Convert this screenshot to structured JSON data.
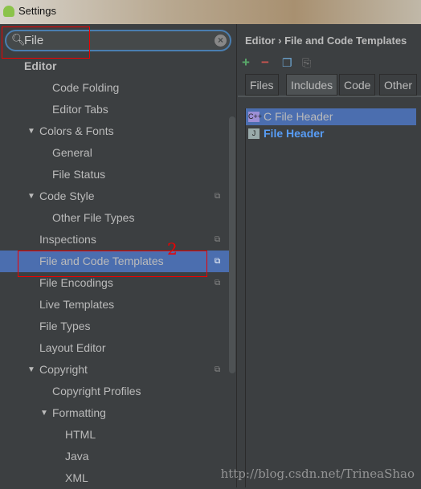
{
  "window": {
    "title": "Settings"
  },
  "search": {
    "value": "File"
  },
  "tree": [
    {
      "label": "Editor",
      "level": 0,
      "bold": true
    },
    {
      "label": "Code Folding",
      "level": 2
    },
    {
      "label": "Editor Tabs",
      "level": 2
    },
    {
      "label": "Colors & Fonts",
      "level": 1,
      "expanded": true
    },
    {
      "label": "General",
      "level": 2
    },
    {
      "label": "File Status",
      "level": 2
    },
    {
      "label": "Code Style",
      "level": 1,
      "expanded": true,
      "project": true
    },
    {
      "label": "Other File Types",
      "level": 2
    },
    {
      "label": "Inspections",
      "level": 1,
      "project": true
    },
    {
      "label": "File and Code Templates",
      "level": 1,
      "project": true,
      "selected": true
    },
    {
      "label": "File Encodings",
      "level": 1,
      "project": true
    },
    {
      "label": "Live Templates",
      "level": 1
    },
    {
      "label": "File Types",
      "level": 1
    },
    {
      "label": "Layout Editor",
      "level": 1
    },
    {
      "label": "Copyright",
      "level": 1,
      "expanded": true,
      "project": true
    },
    {
      "label": "Copyright Profiles",
      "level": 2
    },
    {
      "label": "Formatting",
      "level": 2,
      "expanded": true
    },
    {
      "label": "HTML",
      "level": 3
    },
    {
      "label": "Java",
      "level": 3
    },
    {
      "label": "XML",
      "level": 3
    }
  ],
  "breadcrumb": "Editor › File and Code Templates",
  "toolbar": {
    "add": "+",
    "remove": "−"
  },
  "tabs": [
    {
      "label": "Files"
    },
    {
      "label": "Includes",
      "active": true
    },
    {
      "label": "Code"
    },
    {
      "label": "Other"
    }
  ],
  "includes": [
    {
      "label": "C File Header",
      "icon": "C++",
      "selected": true
    },
    {
      "label": "File Header",
      "icon": "J",
      "bold": true,
      "color": "#589df6"
    }
  ],
  "annotation": "2",
  "watermark": "http://blog.csdn.net/TrineaShao",
  "colors": {
    "selection": "#4b6eaf",
    "background": "#3c3f41",
    "focus": "#4a7eb0",
    "add": "#59a869",
    "remove": "#c75450"
  }
}
